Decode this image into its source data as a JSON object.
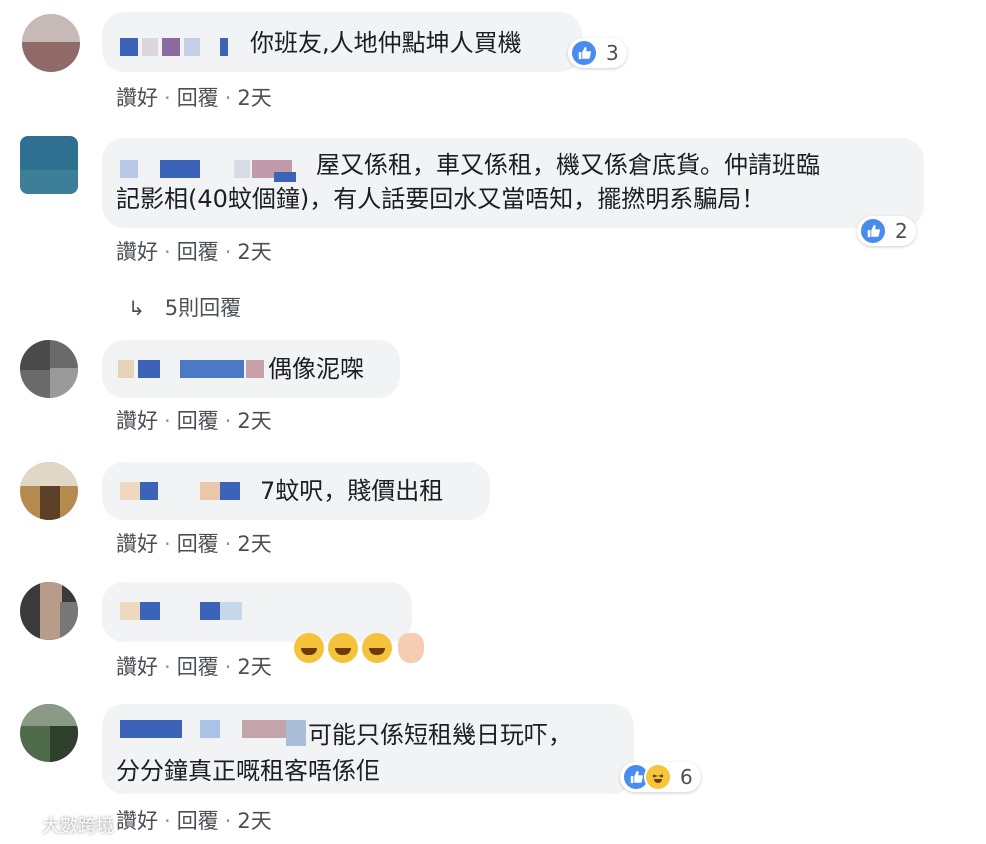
{
  "comments": [
    {
      "text": "你班友,人地仲點坤人買機",
      "like_label": "讚好",
      "reply_label": "回覆",
      "time": "2天",
      "reactions": {
        "types": [
          "like"
        ],
        "count": "3"
      }
    },
    {
      "text_line1": "屋又係租，車又係租，機又係倉底貨。仲請班臨",
      "text_line2": "記影相(40蚊個鐘)，有人話要回水又當唔知，擺撚明系騙局！",
      "like_label": "讚好",
      "reply_label": "回覆",
      "time": "2天",
      "reactions": {
        "types": [
          "like"
        ],
        "count": "2"
      },
      "replies_label": "5則回覆"
    },
    {
      "text": "偶像泥㗎",
      "like_label": "讚好",
      "reply_label": "回覆",
      "time": "2天"
    },
    {
      "text": "7蚊呎，賤價出租",
      "like_label": "讚好",
      "reply_label": "回覆",
      "time": "2天"
    },
    {
      "emojis": [
        "rofl-emoji",
        "rofl-emoji",
        "rofl-emoji",
        "pointing-hand-emoji"
      ],
      "like_label": "讚好",
      "reply_label": "回覆",
      "time": "2天"
    },
    {
      "text_line1": "可能只係短租幾日玩吓，",
      "text_line2": "分分鐘真正嘅租客唔係佢",
      "like_label": "讚好",
      "reply_label": "回覆",
      "time": "2天",
      "reactions": {
        "types": [
          "like",
          "haha"
        ],
        "count": "6"
      }
    }
  ],
  "separator": "·",
  "watermark": "大數跨境",
  "colors": {
    "bubble": "#f2f3f5",
    "like_blue": "#4a8bf0",
    "name_blue": "#3b64b8",
    "meta_text": "#4b4f56"
  }
}
